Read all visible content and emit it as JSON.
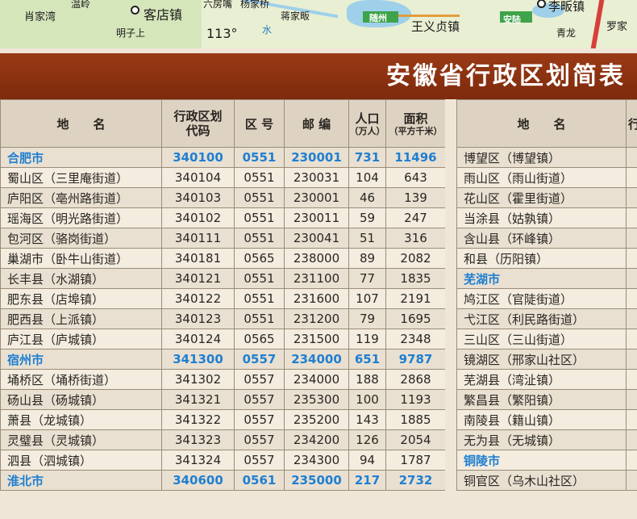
{
  "map": {
    "labels": [
      "肖家湾",
      "温岭",
      "客店镇",
      "六房嘴",
      "杨家桥",
      "蒋家畈",
      "明子上",
      "113°",
      "水",
      "随州",
      "王义贞镇",
      "安陆",
      "李畈镇",
      "青龙",
      "罗家"
    ]
  },
  "banner": {
    "title": "安徽省行政区划简表"
  },
  "left_table": {
    "headers": {
      "name": "地　　名",
      "code_line1": "行政区划",
      "code_line2": "代码",
      "area_code": "区 号",
      "postal": "邮 编",
      "pop_line1": "人口",
      "pop_line2": "（万人）",
      "area_line1": "面积",
      "area_line2": "（平方千米）"
    },
    "rows": [
      {
        "name": "合肥市",
        "code": "340100",
        "area_code": "0551",
        "postal": "230001",
        "pop": "731",
        "area": "11496",
        "city": true
      },
      {
        "name": "蜀山区（三里庵街道）",
        "code": "340104",
        "area_code": "0551",
        "postal": "230031",
        "pop": "104",
        "area": "643",
        "city": false
      },
      {
        "name": "庐阳区（亳州路街道）",
        "code": "340103",
        "area_code": "0551",
        "postal": "230001",
        "pop": "46",
        "area": "139",
        "city": false
      },
      {
        "name": "瑶海区（明光路街道）",
        "code": "340102",
        "area_code": "0551",
        "postal": "230011",
        "pop": "59",
        "area": "247",
        "city": false
      },
      {
        "name": "包河区（骆岗街道）",
        "code": "340111",
        "area_code": "0551",
        "postal": "230041",
        "pop": "51",
        "area": "316",
        "city": false
      },
      {
        "name": "巢湖市（卧牛山街道）",
        "code": "340181",
        "area_code": "0565",
        "postal": "238000",
        "pop": "89",
        "area": "2082",
        "city": false
      },
      {
        "name": "长丰县（水湖镇）",
        "code": "340121",
        "area_code": "0551",
        "postal": "231100",
        "pop": "77",
        "area": "1835",
        "city": false
      },
      {
        "name": "肥东县（店埠镇）",
        "code": "340122",
        "area_code": "0551",
        "postal": "231600",
        "pop": "107",
        "area": "2191",
        "city": false
      },
      {
        "name": "肥西县（上派镇）",
        "code": "340123",
        "area_code": "0551",
        "postal": "231200",
        "pop": "79",
        "area": "1695",
        "city": false
      },
      {
        "name": "庐江县（庐城镇）",
        "code": "340124",
        "area_code": "0565",
        "postal": "231500",
        "pop": "119",
        "area": "2348",
        "city": false
      },
      {
        "name": "宿州市",
        "code": "341300",
        "area_code": "0557",
        "postal": "234000",
        "pop": "651",
        "area": "9787",
        "city": true
      },
      {
        "name": "埇桥区（埇桥街道）",
        "code": "341302",
        "area_code": "0557",
        "postal": "234000",
        "pop": "188",
        "area": "2868",
        "city": false
      },
      {
        "name": "砀山县（砀城镇）",
        "code": "341321",
        "area_code": "0557",
        "postal": "235300",
        "pop": "100",
        "area": "1193",
        "city": false
      },
      {
        "name": "萧县（龙城镇）",
        "code": "341322",
        "area_code": "0557",
        "postal": "235200",
        "pop": "143",
        "area": "1885",
        "city": false
      },
      {
        "name": "灵璧县（灵城镇）",
        "code": "341323",
        "area_code": "0557",
        "postal": "234200",
        "pop": "126",
        "area": "2054",
        "city": false
      },
      {
        "name": "泗县（泗城镇）",
        "code": "341324",
        "area_code": "0557",
        "postal": "234300",
        "pop": "94",
        "area": "1787",
        "city": false
      },
      {
        "name": "淮北市",
        "code": "340600",
        "area_code": "0561",
        "postal": "235000",
        "pop": "217",
        "area": "2732",
        "city": true
      }
    ]
  },
  "right_table": {
    "headers": {
      "name": "地　　名",
      "next": "行"
    },
    "rows": [
      {
        "name": "博望区（博望镇）",
        "city": false
      },
      {
        "name": "雨山区（雨山街道）",
        "city": false
      },
      {
        "name": "花山区（霍里街道）",
        "city": false
      },
      {
        "name": "当涂县（姑孰镇）",
        "city": false
      },
      {
        "name": "含山县（环峰镇）",
        "city": false
      },
      {
        "name": "和县（历阳镇）",
        "city": false
      },
      {
        "name": "芜湖市",
        "city": true
      },
      {
        "name": "鸠江区（官陡街道）",
        "city": false
      },
      {
        "name": "弋江区（利民路街道）",
        "city": false
      },
      {
        "name": "三山区（三山街道）",
        "city": false
      },
      {
        "name": "镜湖区（邢家山社区）",
        "city": false
      },
      {
        "name": "芜湖县（湾沚镇）",
        "city": false
      },
      {
        "name": "繁昌县（繁阳镇）",
        "city": false
      },
      {
        "name": "南陵县（籍山镇）",
        "city": false
      },
      {
        "name": "无为县（无城镇）",
        "city": false
      },
      {
        "name": "铜陵市",
        "city": true
      },
      {
        "name": "铜官区（乌木山社区）",
        "city": false
      }
    ]
  }
}
